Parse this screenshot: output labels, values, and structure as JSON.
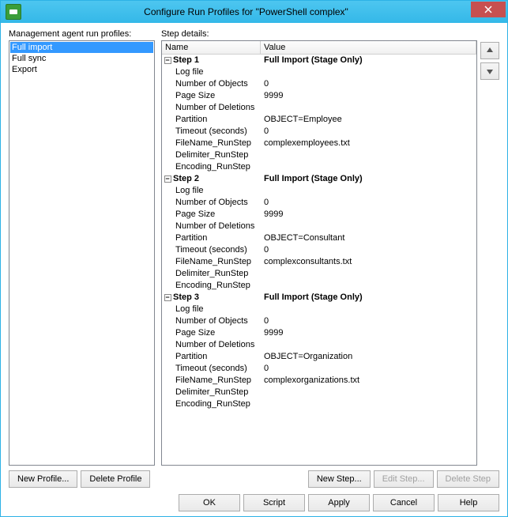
{
  "window": {
    "title": "Configure Run Profiles for \"PowerShell complex\""
  },
  "labels": {
    "profiles": "Management agent run profiles:",
    "details": "Step details:"
  },
  "profiles": [
    {
      "label": "Full import",
      "selected": true
    },
    {
      "label": "Full sync",
      "selected": false
    },
    {
      "label": "Export",
      "selected": false
    }
  ],
  "grid": {
    "columns": {
      "name": "Name",
      "value": "Value"
    }
  },
  "steps": [
    {
      "title": "Step 1",
      "value": "Full Import (Stage Only)",
      "rows": [
        {
          "name": "Log file",
          "value": ""
        },
        {
          "name": "Number of Objects",
          "value": "0"
        },
        {
          "name": "Page Size",
          "value": "9999"
        },
        {
          "name": "Number of Deletions",
          "value": ""
        },
        {
          "name": "Partition",
          "value": "OBJECT=Employee"
        },
        {
          "name": "Timeout (seconds)",
          "value": "0"
        },
        {
          "name": "FileName_RunStep",
          "value": "complexemployees.txt"
        },
        {
          "name": "Delimiter_RunStep",
          "value": ""
        },
        {
          "name": "Encoding_RunStep",
          "value": ""
        }
      ]
    },
    {
      "title": "Step 2",
      "value": "Full Import (Stage Only)",
      "rows": [
        {
          "name": "Log file",
          "value": ""
        },
        {
          "name": "Number of Objects",
          "value": "0"
        },
        {
          "name": "Page Size",
          "value": "9999"
        },
        {
          "name": "Number of Deletions",
          "value": ""
        },
        {
          "name": "Partition",
          "value": "OBJECT=Consultant"
        },
        {
          "name": "Timeout (seconds)",
          "value": "0"
        },
        {
          "name": "FileName_RunStep",
          "value": "complexconsultants.txt"
        },
        {
          "name": "Delimiter_RunStep",
          "value": ""
        },
        {
          "name": "Encoding_RunStep",
          "value": ""
        }
      ]
    },
    {
      "title": "Step 3",
      "value": "Full Import (Stage Only)",
      "rows": [
        {
          "name": "Log file",
          "value": ""
        },
        {
          "name": "Number of Objects",
          "value": "0"
        },
        {
          "name": "Page Size",
          "value": "9999"
        },
        {
          "name": "Number of Deletions",
          "value": ""
        },
        {
          "name": "Partition",
          "value": "OBJECT=Organization"
        },
        {
          "name": "Timeout (seconds)",
          "value": "0"
        },
        {
          "name": "FileName_RunStep",
          "value": "complexorganizations.txt"
        },
        {
          "name": "Delimiter_RunStep",
          "value": ""
        },
        {
          "name": "Encoding_RunStep",
          "value": ""
        }
      ]
    }
  ],
  "buttons": {
    "new_profile": "New Profile...",
    "delete_profile": "Delete Profile",
    "new_step": "New Step...",
    "edit_step": "Edit Step...",
    "delete_step": "Delete Step",
    "ok": "OK",
    "script": "Script",
    "apply": "Apply",
    "cancel": "Cancel",
    "help": "Help"
  }
}
